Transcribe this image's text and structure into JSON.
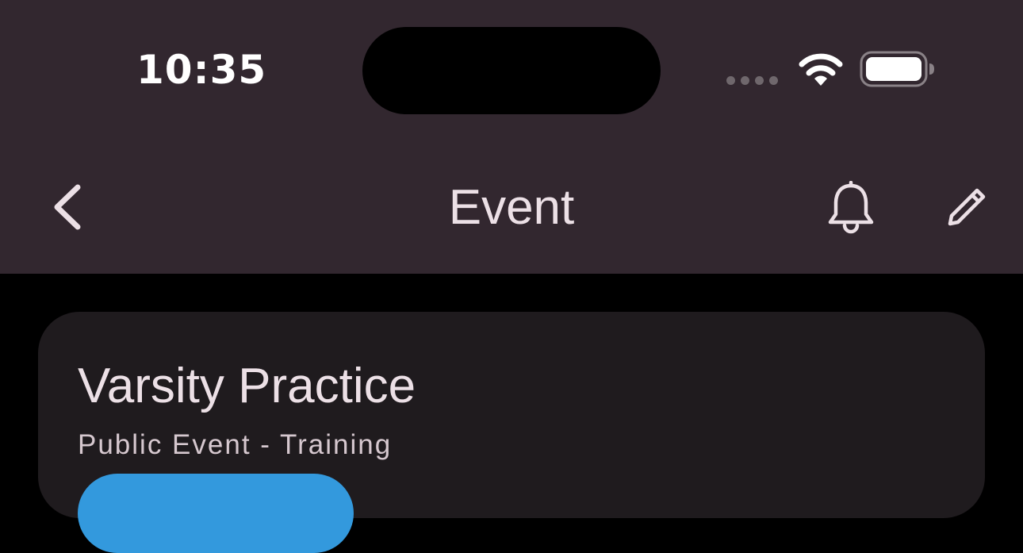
{
  "status_bar": {
    "time": "10:35",
    "signal_icon": "signal-dots-icon",
    "wifi_icon": "wifi-icon",
    "battery_icon": "battery-icon"
  },
  "nav_bar": {
    "title": "Event",
    "back_icon": "chevron-left-icon",
    "bell_icon": "bell-icon",
    "edit_icon": "pencil-icon"
  },
  "event": {
    "title": "Varsity Practice",
    "subtitle": "Public Event - Training"
  },
  "colors": {
    "header_bg": "#32272f",
    "page_bg": "#000000",
    "card_bg": "#1f1b1e",
    "accent": "#3399dd",
    "text_primary": "#ece0e6"
  }
}
